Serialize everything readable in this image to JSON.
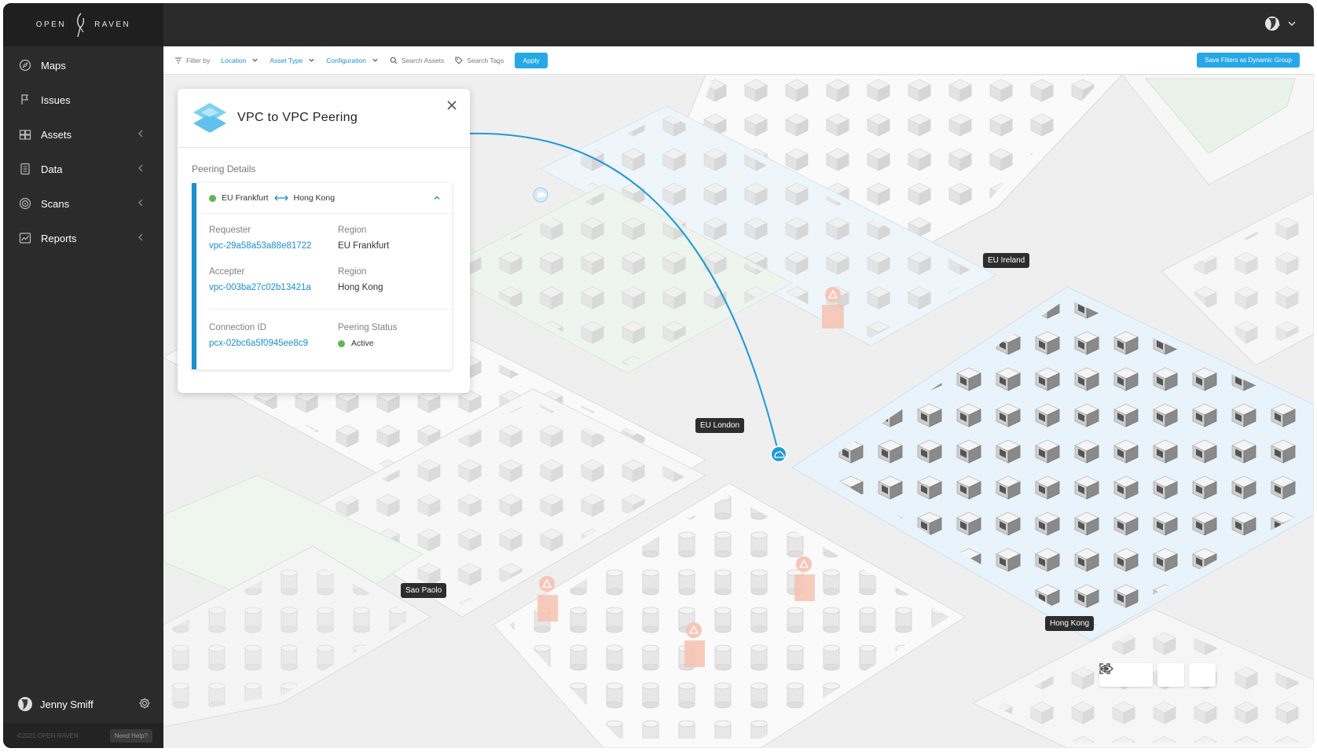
{
  "brand": {
    "left": "OPEN",
    "right": "RAVEN"
  },
  "sidebar": {
    "items": [
      {
        "label": "Maps",
        "icon": "compass-icon"
      },
      {
        "label": "Issues",
        "icon": "flag-icon"
      },
      {
        "label": "Assets",
        "icon": "assets-icon"
      },
      {
        "label": "Data",
        "icon": "data-icon"
      },
      {
        "label": "Scans",
        "icon": "target-icon"
      },
      {
        "label": "Reports",
        "icon": "chart-icon"
      }
    ],
    "user": "Jenny Smiff",
    "copyright": "©2021 OPEN RAVEN",
    "help": "Need Help?"
  },
  "filterbar": {
    "filter_by": "Filter by",
    "location": "Location",
    "asset_type": "Asset Type",
    "configuration": "Configuration",
    "search_assets": "Search Assets",
    "search_tags": "Search Tags",
    "apply": "Apply",
    "save": "Save Filters as Dynamic Group"
  },
  "map": {
    "labels": {
      "ireland": "EU Ireland",
      "london": "EU London",
      "sao_paolo": "Sao Paolo",
      "hong_kong": "Hong Kong"
    },
    "accent": "#1f9ad6"
  },
  "panel": {
    "title": "VPC to VPC Peering",
    "section": "Peering Details",
    "route": {
      "from": "EU Frankfurt",
      "to": "Hong Kong"
    },
    "requester_label": "Requester",
    "requester_value": "vpc-29a58a53a88e81722",
    "region1_label": "Region",
    "region1_value": "EU Frankfurt",
    "accepter_label": "Accepter",
    "accepter_value": "vpc-003ba27c02b13421a",
    "region2_label": "Region",
    "region2_value": "Hong Kong",
    "connection_label": "Connection ID",
    "connection_value": "pcx-02bc6a5f0945ee8c9",
    "status_label": "Peering Status",
    "status_value": "Active",
    "status_color": "#5cb85c"
  }
}
